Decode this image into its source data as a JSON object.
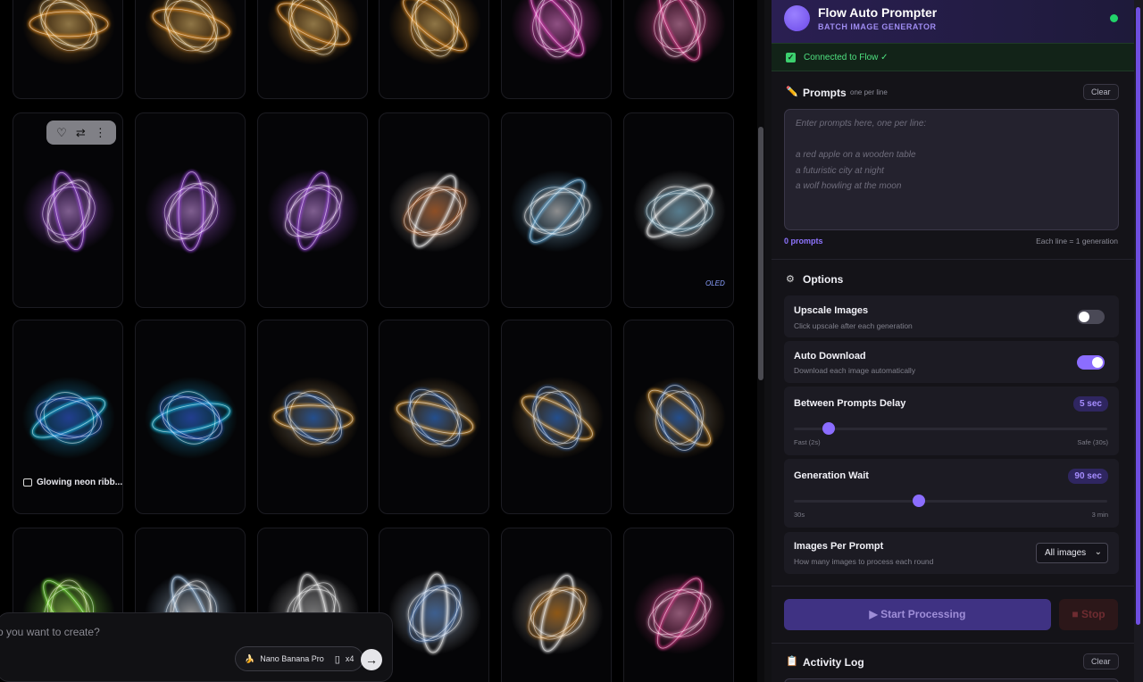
{
  "gallery": {
    "tiles": [
      {
        "name": "tile-face-orange-1",
        "colors": [
          "#ff9a1f",
          "#ffd27a"
        ]
      },
      {
        "name": "tile-face-orange-2",
        "colors": [
          "#ff9a1f",
          "#ffd27a"
        ]
      },
      {
        "name": "tile-face-orange-3",
        "colors": [
          "#ff9a1f",
          "#ffd27a"
        ]
      },
      {
        "name": "tile-face-orange-4",
        "colors": [
          "#ff9a1f",
          "#ffd27a"
        ]
      },
      {
        "name": "tile-pink-star",
        "colors": [
          "#ff3fd1",
          "#ff8ee8"
        ]
      },
      {
        "name": "tile-pink-flower-top",
        "colors": [
          "#ff3f9e",
          "#ff9ecf"
        ]
      },
      {
        "name": "tile-ribbon-1",
        "colors": [
          "#b04dff",
          "#e3a8ff"
        ]
      },
      {
        "name": "tile-ribbon-2",
        "colors": [
          "#b04dff",
          "#e3a8ff"
        ]
      },
      {
        "name": "tile-ribbon-3",
        "colors": [
          "#b04dff",
          "#e3a8ff"
        ]
      },
      {
        "name": "tile-cloud-1",
        "colors": [
          "#ffffff",
          "#ff8a3d"
        ]
      },
      {
        "name": "tile-cloud-2",
        "colors": [
          "#6fc7ff",
          "#ffffff"
        ]
      },
      {
        "name": "tile-cloud-3",
        "colors": [
          "#ffffff",
          "#9adfff"
        ]
      },
      {
        "name": "tile-drop-1",
        "colors": [
          "#19d8ff",
          "#3a6bff"
        ]
      },
      {
        "name": "tile-drop-2",
        "colors": [
          "#19d8ff",
          "#3a6bff"
        ]
      },
      {
        "name": "tile-knot-1",
        "colors": [
          "#ffb13a",
          "#3b8bff"
        ]
      },
      {
        "name": "tile-knot-2",
        "colors": [
          "#ffb13a",
          "#3b8bff"
        ]
      },
      {
        "name": "tile-wave-1",
        "colors": [
          "#ffb13a",
          "#3b8bff"
        ]
      },
      {
        "name": "tile-wave-2",
        "colors": [
          "#ffb13a",
          "#3b8bff"
        ]
      },
      {
        "name": "tile-tree",
        "colors": [
          "#7dff3a",
          "#c8ff6a"
        ]
      },
      {
        "name": "tile-feather-1",
        "colors": [
          "#a8d4ff",
          "#ffffff"
        ]
      },
      {
        "name": "tile-feather-2",
        "colors": [
          "#ffffff",
          "#cccccc"
        ]
      },
      {
        "name": "tile-feather-3",
        "colors": [
          "#ffffff",
          "#6aa8ff"
        ]
      },
      {
        "name": "tile-feather-4",
        "colors": [
          "#ffffff",
          "#ff9a1f"
        ]
      },
      {
        "name": "tile-flower",
        "colors": [
          "#ff3f9e",
          "#ff9ecf"
        ]
      }
    ],
    "hovered_caption": "Glowing neon ribb...",
    "oled_label": "OLED",
    "hover_actions": [
      "♡",
      "⇄",
      "⋮"
    ]
  },
  "composer": {
    "placeholder": "o you want to create?",
    "model_emoji": "🍌",
    "model": "Nano Banana Pro",
    "aspect_icon": "▯",
    "count": "x4",
    "send_icon": "→"
  },
  "panel": {
    "title": "Flow Auto Prompter",
    "subtitle": "BATCH IMAGE GENERATOR",
    "connected": "Connected to Flow ✓",
    "prompts": {
      "title": "Prompts",
      "hint": "one per line",
      "clear": "Clear",
      "placeholder_lines": [
        "Enter prompts here, one per line:",
        "",
        "a red apple on a wooden table",
        "a futuristic city at night",
        "a wolf howling at the moon"
      ],
      "count": "0 prompts",
      "each_line": "Each line = 1 generation"
    },
    "options": {
      "title": "Options",
      "upscale": {
        "title": "Upscale Images",
        "desc": "Click upscale after each generation",
        "on": false
      },
      "auto_download": {
        "title": "Auto Download",
        "desc": "Download each image automatically",
        "on": true
      },
      "delay": {
        "title": "Between Prompts Delay",
        "value": "5 sec",
        "min_label": "Fast (2s)",
        "max_label": "Safe (30s)",
        "fraction": 0.11
      },
      "wait": {
        "title": "Generation Wait",
        "value": "90 sec",
        "min_label": "30s",
        "max_label": "3 min",
        "fraction": 0.4
      },
      "images_per_prompt": {
        "title": "Images Per Prompt",
        "desc": "How many images to process each round",
        "selected": "All images"
      }
    },
    "start": "▶ Start Processing",
    "stop": "■ Stop",
    "log": {
      "title": "Activity Log",
      "clear": "Clear"
    }
  },
  "colors": {
    "accent": "#8b6dff",
    "success": "#3ccf6e",
    "toggle_off": "#4a4956"
  }
}
